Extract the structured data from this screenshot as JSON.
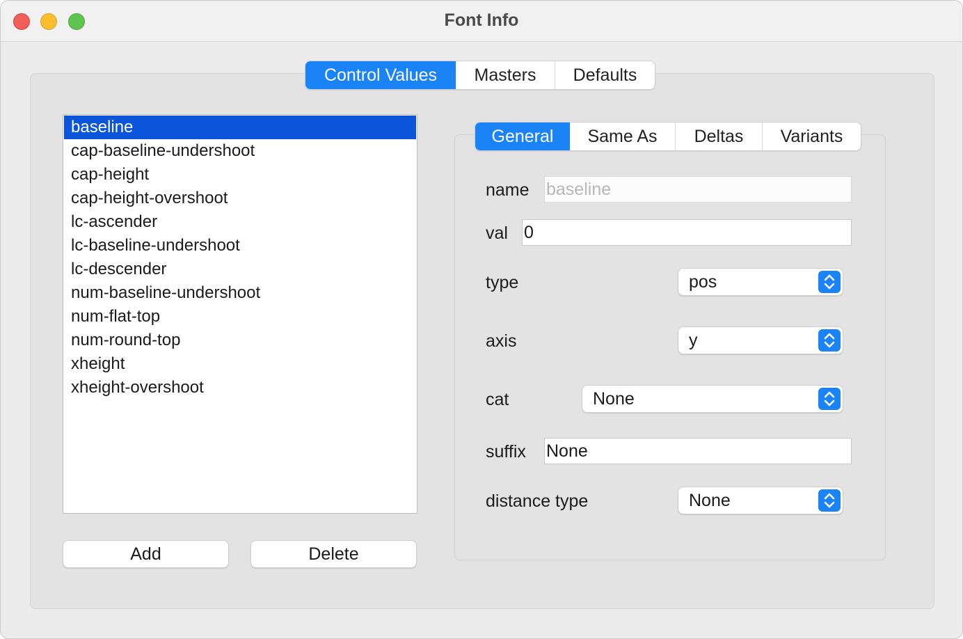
{
  "window": {
    "title": "Font Info"
  },
  "top_tabs": [
    {
      "label": "Control Values",
      "active": true
    },
    {
      "label": "Masters",
      "active": false
    },
    {
      "label": "Defaults",
      "active": false
    }
  ],
  "control_values": {
    "items": [
      "baseline",
      "cap-baseline-undershoot",
      "cap-height",
      "cap-height-overshoot",
      "lc-ascender",
      "lc-baseline-undershoot",
      "lc-descender",
      "num-baseline-undershoot",
      "num-flat-top",
      "num-round-top",
      "xheight",
      "xheight-overshoot"
    ],
    "selected": "baseline",
    "add_label": "Add",
    "delete_label": "Delete"
  },
  "detail_tabs": [
    {
      "label": "General",
      "active": true
    },
    {
      "label": "Same As",
      "active": false
    },
    {
      "label": "Deltas",
      "active": false
    },
    {
      "label": "Variants",
      "active": false
    }
  ],
  "general": {
    "name_label": "name",
    "name_placeholder": "baseline",
    "val_label": "val",
    "val_value": "0",
    "type_label": "type",
    "type_value": "pos",
    "axis_label": "axis",
    "axis_value": "y",
    "cat_label": "cat",
    "cat_value": "None",
    "suffix_label": "suffix",
    "suffix_value": "None",
    "distance_type_label": "distance type",
    "distance_type_value": "None"
  },
  "colors": {
    "accent": "#1a84f7",
    "selection": "#0a55d9",
    "close": "#ee5f58",
    "minimize": "#f8bd30",
    "zoom": "#5fc452"
  }
}
